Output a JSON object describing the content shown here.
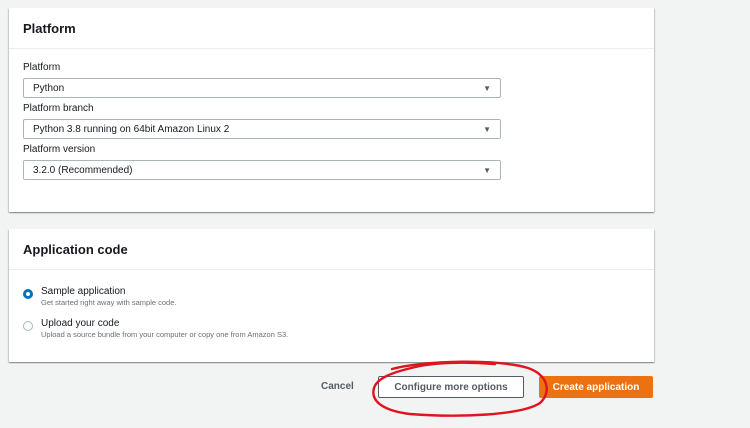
{
  "platform_panel": {
    "title": "Platform",
    "fields": [
      {
        "label": "Platform",
        "value": "Python"
      },
      {
        "label": "Platform branch",
        "value": "Python 3.8 running on 64bit Amazon Linux 2"
      },
      {
        "label": "Platform version",
        "value": "3.2.0 (Recommended)"
      }
    ]
  },
  "code_panel": {
    "title": "Application code",
    "options": [
      {
        "title": "Sample application",
        "description": "Get started right away with sample code.",
        "selected": true
      },
      {
        "title": "Upload your code",
        "description": "Upload a source bundle from your computer or copy one from Amazon S3.",
        "selected": false
      }
    ]
  },
  "actions": {
    "cancel_label": "Cancel",
    "configure_label": "Configure more options",
    "create_label": "Create application"
  },
  "colors": {
    "primary": "#ec7211",
    "radio_selected": "#0073bb",
    "annotation": "#e0141e"
  },
  "icons": {
    "select_caret": "caret-down-icon"
  }
}
